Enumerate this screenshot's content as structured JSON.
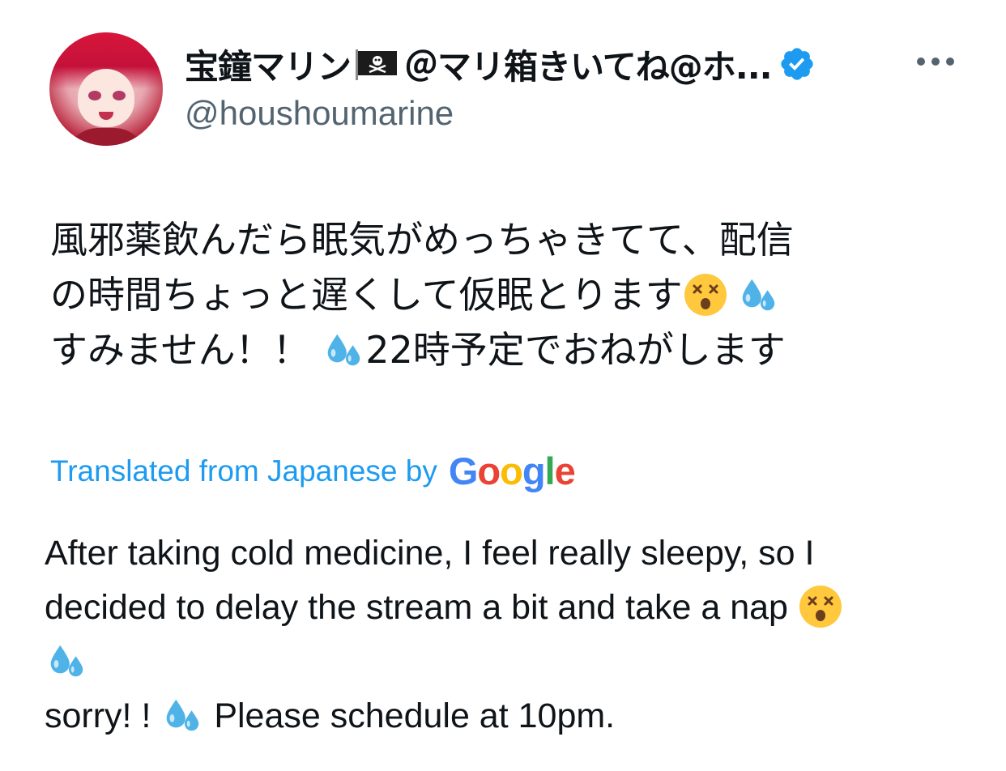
{
  "author": {
    "display_name_prefix": "宝鐘マリン",
    "display_name_suffix": "＠マリ箱きいてね@ホ...",
    "handle": "@houshoumarine",
    "verified": true,
    "flag_icon": "pirate-flag-icon"
  },
  "tweet": {
    "jp_line1": "風邪薬飲んだら眠気がめっちゃきてて、配信",
    "jp_line2": "の時間ちょっと遅くして仮眠とります",
    "jp_line3_a": "すみません！！",
    "jp_line3_b": "22時予定でおねがします",
    "translation_label": "Translated from Japanese by",
    "translation_provider": "Google",
    "en_line1": "After taking cold medicine, I feel really sleepy, so I",
    "en_line2": "decided to delay the stream a bit and take a nap",
    "en_line4_a": "sorry! !",
    "en_line4_b": "Please schedule at 10pm."
  },
  "icons": {
    "dizzy": "dizzy-face-emoji-icon",
    "sweat": "sweat-droplets-emoji-icon",
    "more": "more-options-icon"
  },
  "colors": {
    "link": "#1d9bf0",
    "secondary_text": "#536471",
    "primary_text": "#0f1419",
    "google_blue": "#4285F4",
    "google_red": "#EA4335",
    "google_yellow": "#FBBC05",
    "google_green": "#34A853"
  }
}
